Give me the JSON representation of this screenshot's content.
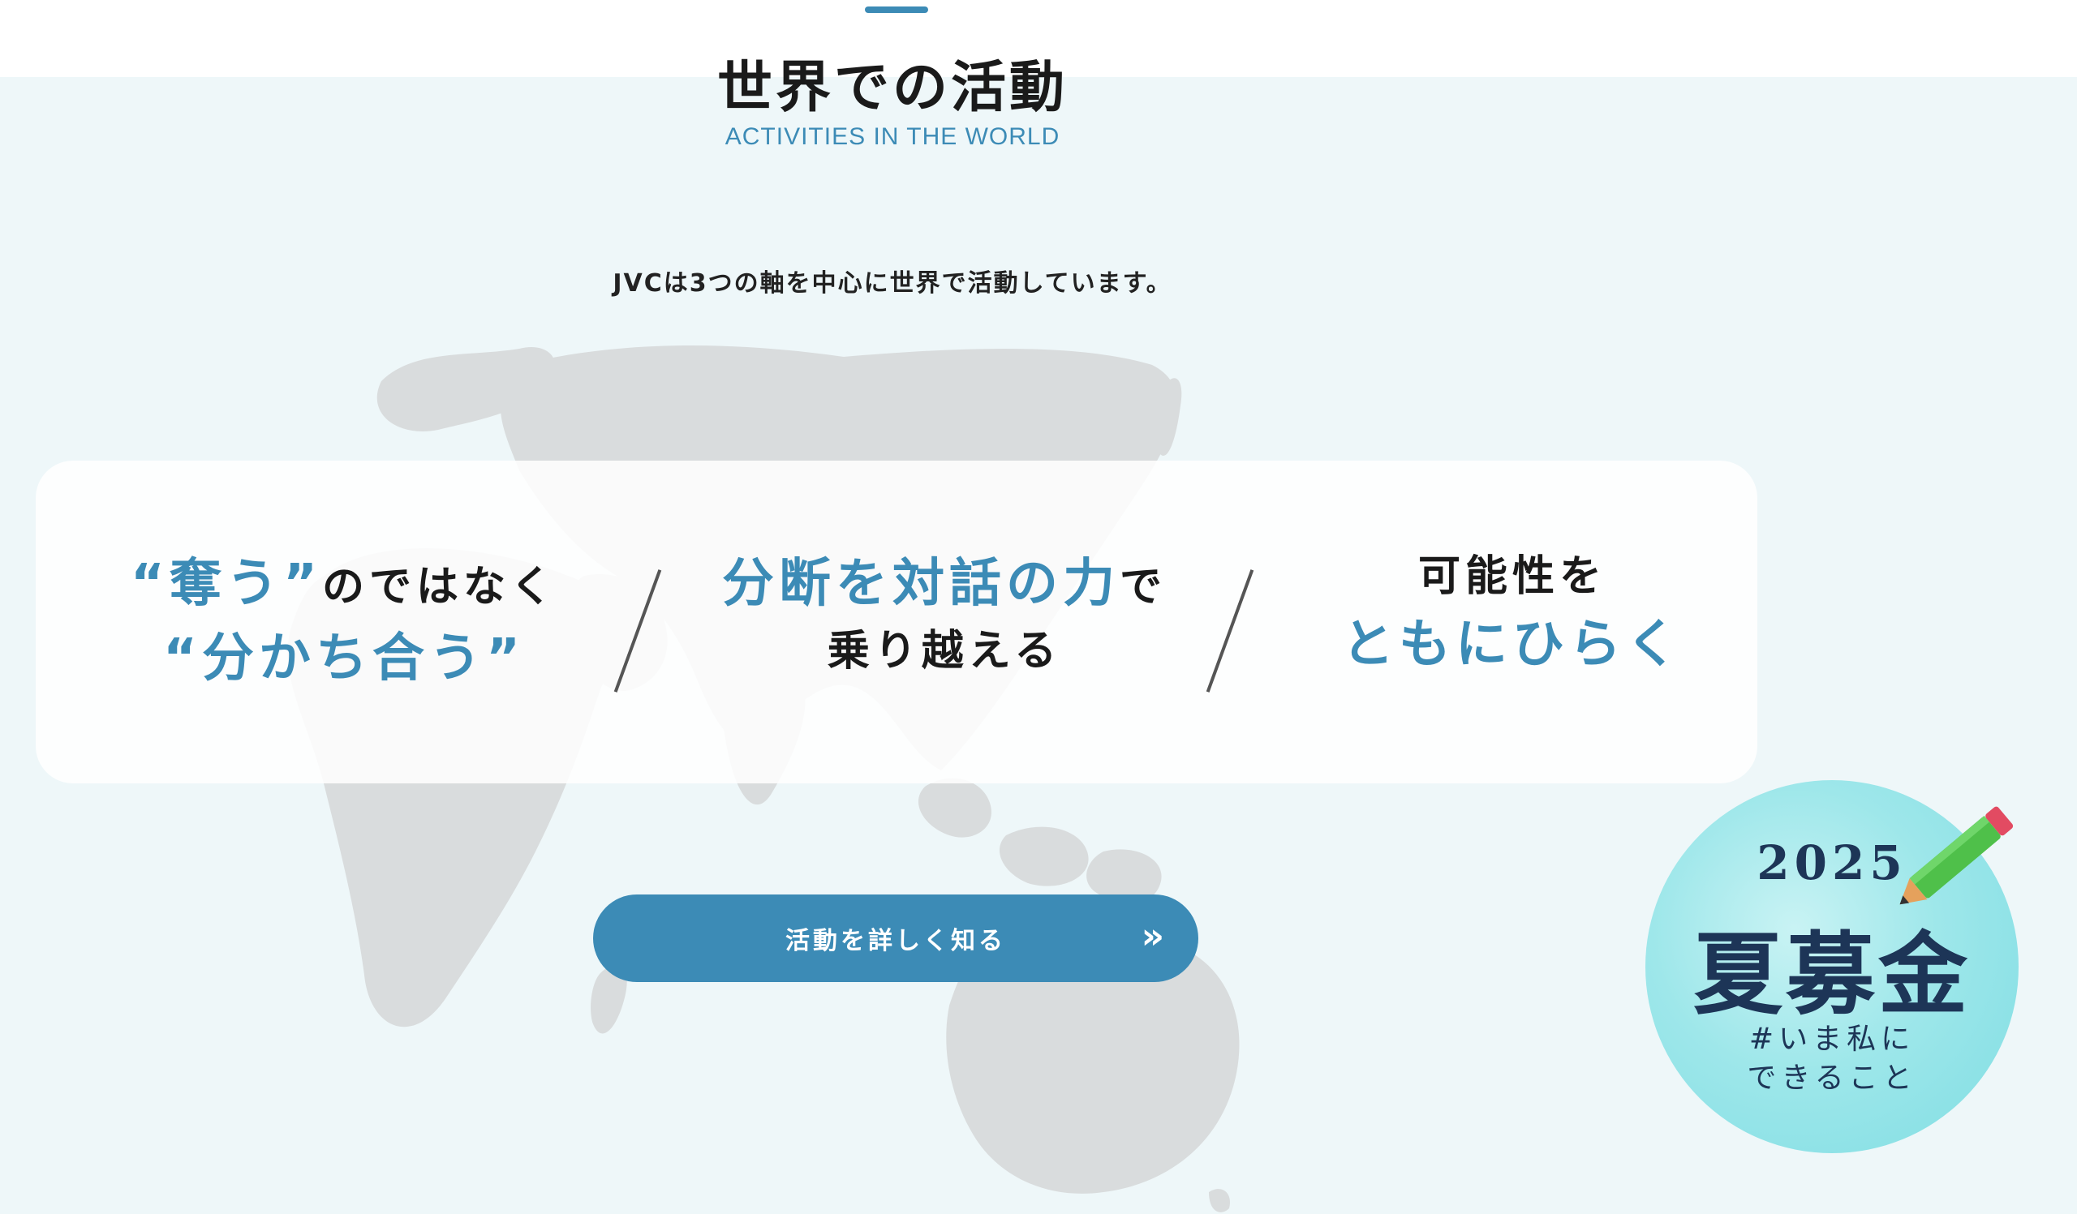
{
  "section": {
    "title": "世界での活動",
    "subtitle": "ACTIVITIES IN THE WORLD",
    "lead": "JVCは3つの軸を中心に世界で活動しています。"
  },
  "pillars": [
    {
      "line1_blue": "“奪う”",
      "line1_dark": "のではなく",
      "line2_blue": "“分かち合う”"
    },
    {
      "line1_blue": "分断を対話の力",
      "line1_dark": "で",
      "line2_dark": "乗り越える"
    },
    {
      "line1_dark": "可能性を",
      "line2_blue": "ともにひらく"
    }
  ],
  "cta": {
    "label": "活動を詳しく知る",
    "arrow": "»"
  },
  "badge": {
    "year": "2025",
    "title": "夏募金",
    "sub1": "#いま私に",
    "sub2": "できること"
  },
  "colors": {
    "accent": "#3c8bb6",
    "background": "#eef7f9",
    "map": "#d9dcdd",
    "badge": "#8fe3e7"
  },
  "icons": {
    "cta_arrow": "double-chevron-right-icon",
    "badge_pencil": "pencil-icon",
    "background_map": "world-map-icon"
  }
}
